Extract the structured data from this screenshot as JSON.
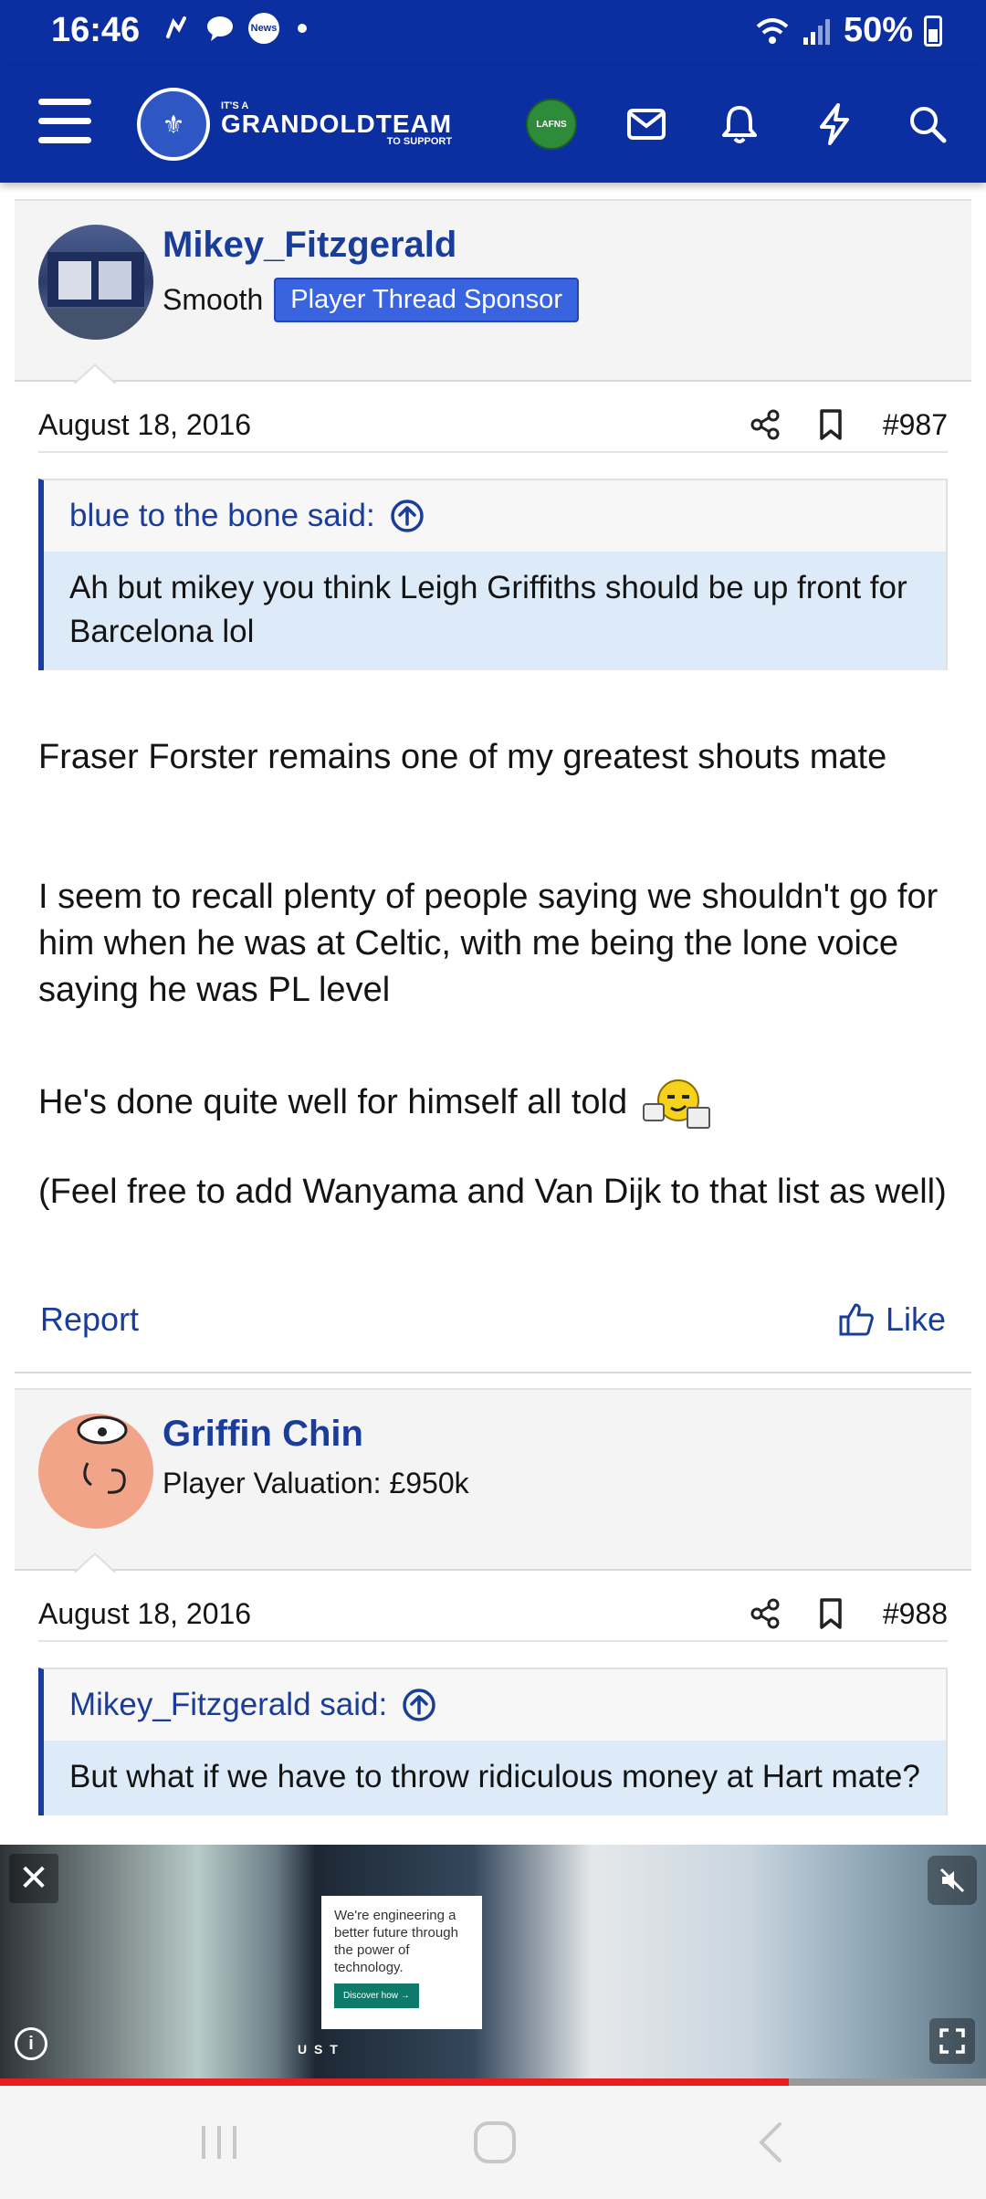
{
  "status": {
    "time": "16:46",
    "news_label": "News",
    "battery": "50%"
  },
  "header": {
    "logo_top": "IT'S A",
    "logo_main": "GRANDOLDTEAM",
    "logo_bottom": "TO SUPPORT",
    "avatar_text": "LAFNS"
  },
  "posts": [
    {
      "username": "Mikey_Fitzgerald",
      "user_title": "Smooth",
      "banner": "Player Thread Sponsor",
      "date": "August 18, 2016",
      "post_number": "#987",
      "quote_author": "blue to the bone said:",
      "quote_text": "Ah but mikey you think Leigh Griffiths should be up front for Barcelona lol",
      "paragraphs": [
        "Fraser Forster remains one of my greatest shouts mate",
        "I seem to recall plenty of people saying we shouldn't go for him when he was at Celtic, with me being the lone voice saying he was PL level",
        "He's done quite well for himself all told",
        "(Feel free to add Wanyama and Van Dijk to that list as well)"
      ],
      "report_label": "Report",
      "like_label": "Like"
    },
    {
      "username": "Griffin Chin",
      "user_title": "Player Valuation: £950k",
      "date": "August 18, 2016",
      "post_number": "#988",
      "quote_author": "Mikey_Fitzgerald said:",
      "quote_text": "But what if we have to throw ridiculous money at Hart mate?"
    }
  ],
  "ad": {
    "headline": "We're engineering a better future through the power of technology.",
    "cta": "Discover how →",
    "brand": "U S T",
    "progress_fraction": 0.8
  },
  "colors": {
    "brand_blue": "#0b2fa0",
    "link_blue": "#1a3d9a",
    "banner_blue": "#3a63e0",
    "quote_bg": "#dcebf7"
  }
}
